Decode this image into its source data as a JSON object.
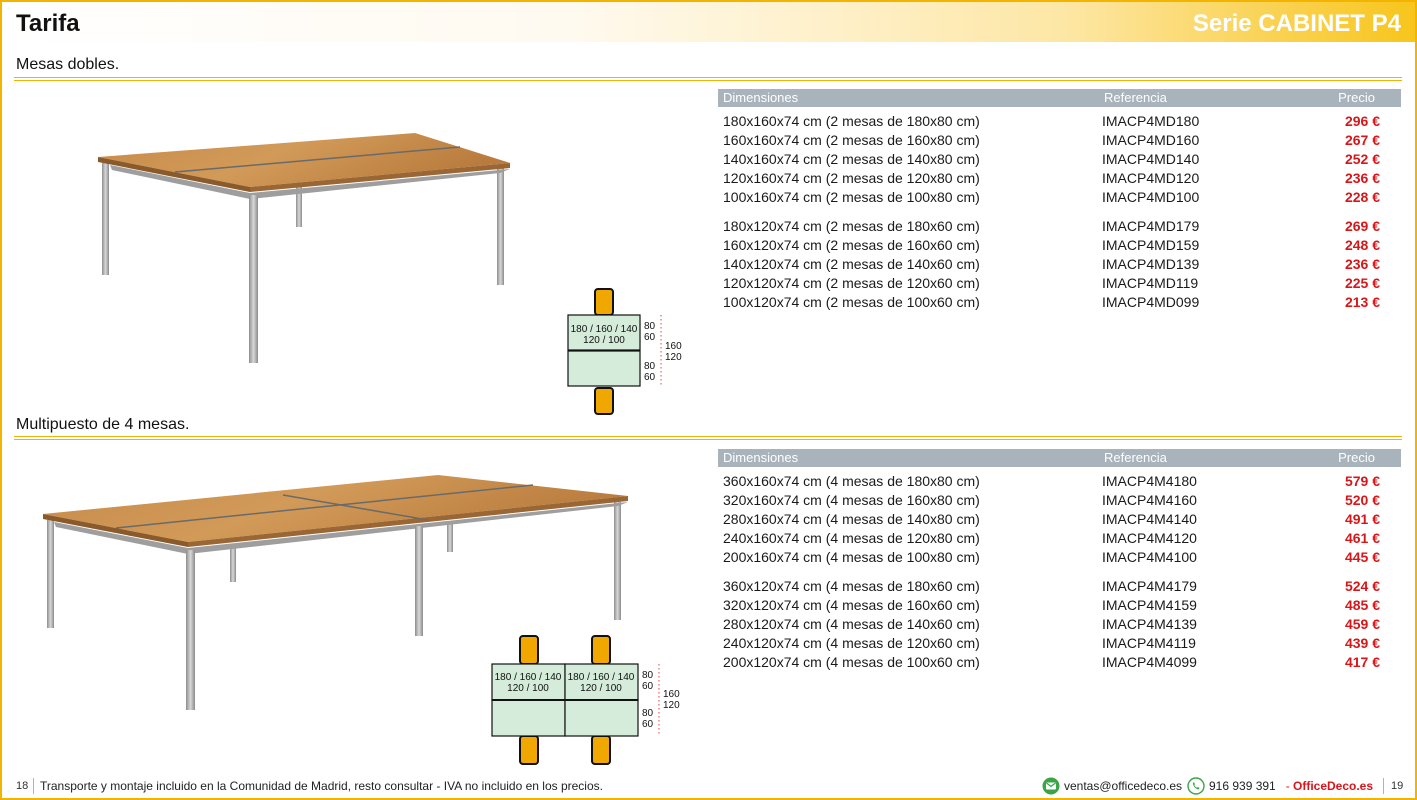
{
  "header": {
    "title": "Tarifa",
    "series": "Serie CABINET P4"
  },
  "sections": [
    {
      "title": "Mesas dobles.",
      "table": {
        "headers": {
          "dimensions": "Dimensiones",
          "reference": "Referencia",
          "price": "Precio"
        },
        "groups": [
          [
            {
              "dim": "180x160x74 cm (2 mesas de 180x80 cm)",
              "ref": "IMACP4MD180",
              "price": "296 €"
            },
            {
              "dim": "160x160x74 cm (2 mesas de 160x80 cm)",
              "ref": "IMACP4MD160",
              "price": "267 €"
            },
            {
              "dim": "140x160x74 cm (2 mesas de 140x80 cm)",
              "ref": "IMACP4MD140",
              "price": "252 €"
            },
            {
              "dim": "120x160x74 cm (2 mesas de 120x80 cm)",
              "ref": "IMACP4MD120",
              "price": "236 €"
            },
            {
              "dim": "100x160x74 cm (2 mesas de 100x80 cm)",
              "ref": "IMACP4MD100",
              "price": "228 €"
            }
          ],
          [
            {
              "dim": "180x120x74 cm (2 mesas de 180x60 cm)",
              "ref": "IMACP4MD179",
              "price": "269 €"
            },
            {
              "dim": "160x120x74 cm (2 mesas de 160x60 cm)",
              "ref": "IMACP4MD159",
              "price": "248 €"
            },
            {
              "dim": "140x120x74 cm (2 mesas de 140x60 cm)",
              "ref": "IMACP4MD139",
              "price": "236 €"
            },
            {
              "dim": "120x120x74 cm (2 mesas de 120x60 cm)",
              "ref": "IMACP4MD119",
              "price": "225 €"
            },
            {
              "dim": "100x120x74 cm (2 mesas de 100x60 cm)",
              "ref": "IMACP4MD099",
              "price": "213 €"
            }
          ]
        ]
      },
      "plan": {
        "width_label_1": "180 / 160 / 140",
        "width_label_2": "120 / 100",
        "depth_a": "80",
        "depth_b": "60",
        "total_a": "160",
        "total_b": "120"
      }
    },
    {
      "title": "Multipuesto de 4 mesas.",
      "table": {
        "headers": {
          "dimensions": "Dimensiones",
          "reference": "Referencia",
          "price": "Precio"
        },
        "groups": [
          [
            {
              "dim": "360x160x74 cm (4 mesas de 180x80 cm)",
              "ref": "IMACP4M4180",
              "price": "579 €"
            },
            {
              "dim": "320x160x74 cm (4 mesas de 160x80 cm)",
              "ref": "IMACP4M4160",
              "price": "520 €"
            },
            {
              "dim": "280x160x74 cm (4 mesas de 140x80 cm)",
              "ref": "IMACP4M4140",
              "price": "491 €"
            },
            {
              "dim": "240x160x74 cm (4 mesas de 120x80 cm)",
              "ref": "IMACP4M4120",
              "price": "461 €"
            },
            {
              "dim": "200x160x74 cm (4 mesas de 100x80 cm)",
              "ref": "IMACP4M4100",
              "price": "445 €"
            }
          ],
          [
            {
              "dim": "360x120x74 cm (4 mesas de 180x60 cm)",
              "ref": "IMACP4M4179",
              "price": "524 €"
            },
            {
              "dim": "320x120x74 cm (4 mesas de 160x60 cm)",
              "ref": "IMACP4M4159",
              "price": "485 €"
            },
            {
              "dim": "280x120x74 cm (4 mesas de 140x60 cm)",
              "ref": "IMACP4M4139",
              "price": "459 €"
            },
            {
              "dim": "240x120x74 cm (4 mesas de 120x60 cm)",
              "ref": "IMACP4M4119",
              "price": "439 €"
            },
            {
              "dim": "200x120x74 cm (4 mesas de 100x60 cm)",
              "ref": "IMACP4M4099",
              "price": "417 €"
            }
          ]
        ]
      },
      "plan": {
        "width_label_1": "180 / 160 / 140",
        "width_label_2": "120 / 100",
        "depth_a": "80",
        "depth_b": "60",
        "total_a": "160",
        "total_b": "120"
      }
    }
  ],
  "footer": {
    "page_left": "18",
    "text": "Transporte y montaje incluido en la Comunidad de Madrid, resto consultar - IVA no incluido en los precios.",
    "email": "ventas@officedeco.es",
    "phone": "916 939 391",
    "separator": "-",
    "brand": "OfficeDeco.es",
    "page_right": "19"
  },
  "colors": {
    "accent": "#f3b400",
    "price": "#d7161a",
    "table_header": "#a9b3bc",
    "plan_fill": "#d4ecd9",
    "chair": "#f0a800"
  }
}
